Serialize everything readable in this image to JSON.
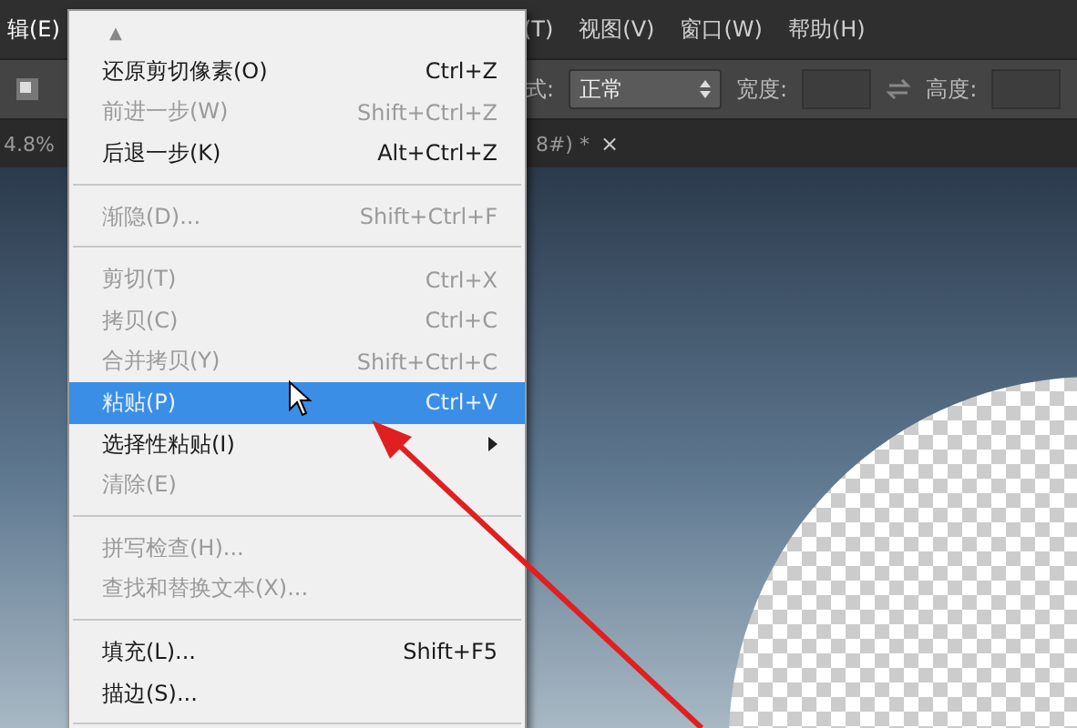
{
  "menu_bar": {
    "items": [
      {
        "label": "辑(E)",
        "selected": true
      },
      {
        "label": "(T)",
        "selected": false
      },
      {
        "label": "视图(V)",
        "selected": false
      },
      {
        "label": "窗口(W)",
        "selected": false
      },
      {
        "label": "帮助(H)",
        "selected": false
      }
    ]
  },
  "options_bar": {
    "mode_label": "式:",
    "mode_value": "正常",
    "width_label": "宽度:",
    "height_label": "高度:"
  },
  "document_tabs": {
    "zoom": "4.8%",
    "tab_title": "8#) *",
    "close": "×"
  },
  "edit_menu": {
    "scroll_up": "▲",
    "items": [
      {
        "kind": "item",
        "label": "还原剪切像素(O)",
        "shortcut": "Ctrl+Z",
        "disabled": false,
        "selected": false,
        "submenu": false
      },
      {
        "kind": "item",
        "label": "前进一步(W)",
        "shortcut": "Shift+Ctrl+Z",
        "disabled": true,
        "selected": false,
        "submenu": false
      },
      {
        "kind": "item",
        "label": "后退一步(K)",
        "shortcut": "Alt+Ctrl+Z",
        "disabled": false,
        "selected": false,
        "submenu": false
      },
      {
        "kind": "separator"
      },
      {
        "kind": "item",
        "label": "渐隐(D)...",
        "shortcut": "Shift+Ctrl+F",
        "disabled": true,
        "selected": false,
        "submenu": false
      },
      {
        "kind": "separator"
      },
      {
        "kind": "item",
        "label": "剪切(T)",
        "shortcut": "Ctrl+X",
        "disabled": true,
        "selected": false,
        "submenu": false
      },
      {
        "kind": "item",
        "label": "拷贝(C)",
        "shortcut": "Ctrl+C",
        "disabled": true,
        "selected": false,
        "submenu": false
      },
      {
        "kind": "item",
        "label": "合并拷贝(Y)",
        "shortcut": "Shift+Ctrl+C",
        "disabled": true,
        "selected": false,
        "submenu": false
      },
      {
        "kind": "item",
        "label": "粘贴(P)",
        "shortcut": "Ctrl+V",
        "disabled": false,
        "selected": true,
        "submenu": false
      },
      {
        "kind": "item",
        "label": "选择性粘贴(I)",
        "disabled": false,
        "selected": false,
        "submenu": true
      },
      {
        "kind": "item",
        "label": "清除(E)",
        "disabled": true,
        "selected": false,
        "submenu": false
      },
      {
        "kind": "separator"
      },
      {
        "kind": "item",
        "label": "拼写检查(H)...",
        "disabled": true,
        "selected": false,
        "submenu": false
      },
      {
        "kind": "item",
        "label": "查找和替换文本(X)...",
        "disabled": true,
        "selected": false,
        "submenu": false
      },
      {
        "kind": "separator"
      },
      {
        "kind": "item",
        "label": "填充(L)...",
        "shortcut": "Shift+F5",
        "disabled": false,
        "selected": false,
        "submenu": false
      },
      {
        "kind": "item",
        "label": "描边(S)...",
        "disabled": false,
        "selected": false,
        "submenu": false
      },
      {
        "kind": "separator"
      }
    ]
  }
}
